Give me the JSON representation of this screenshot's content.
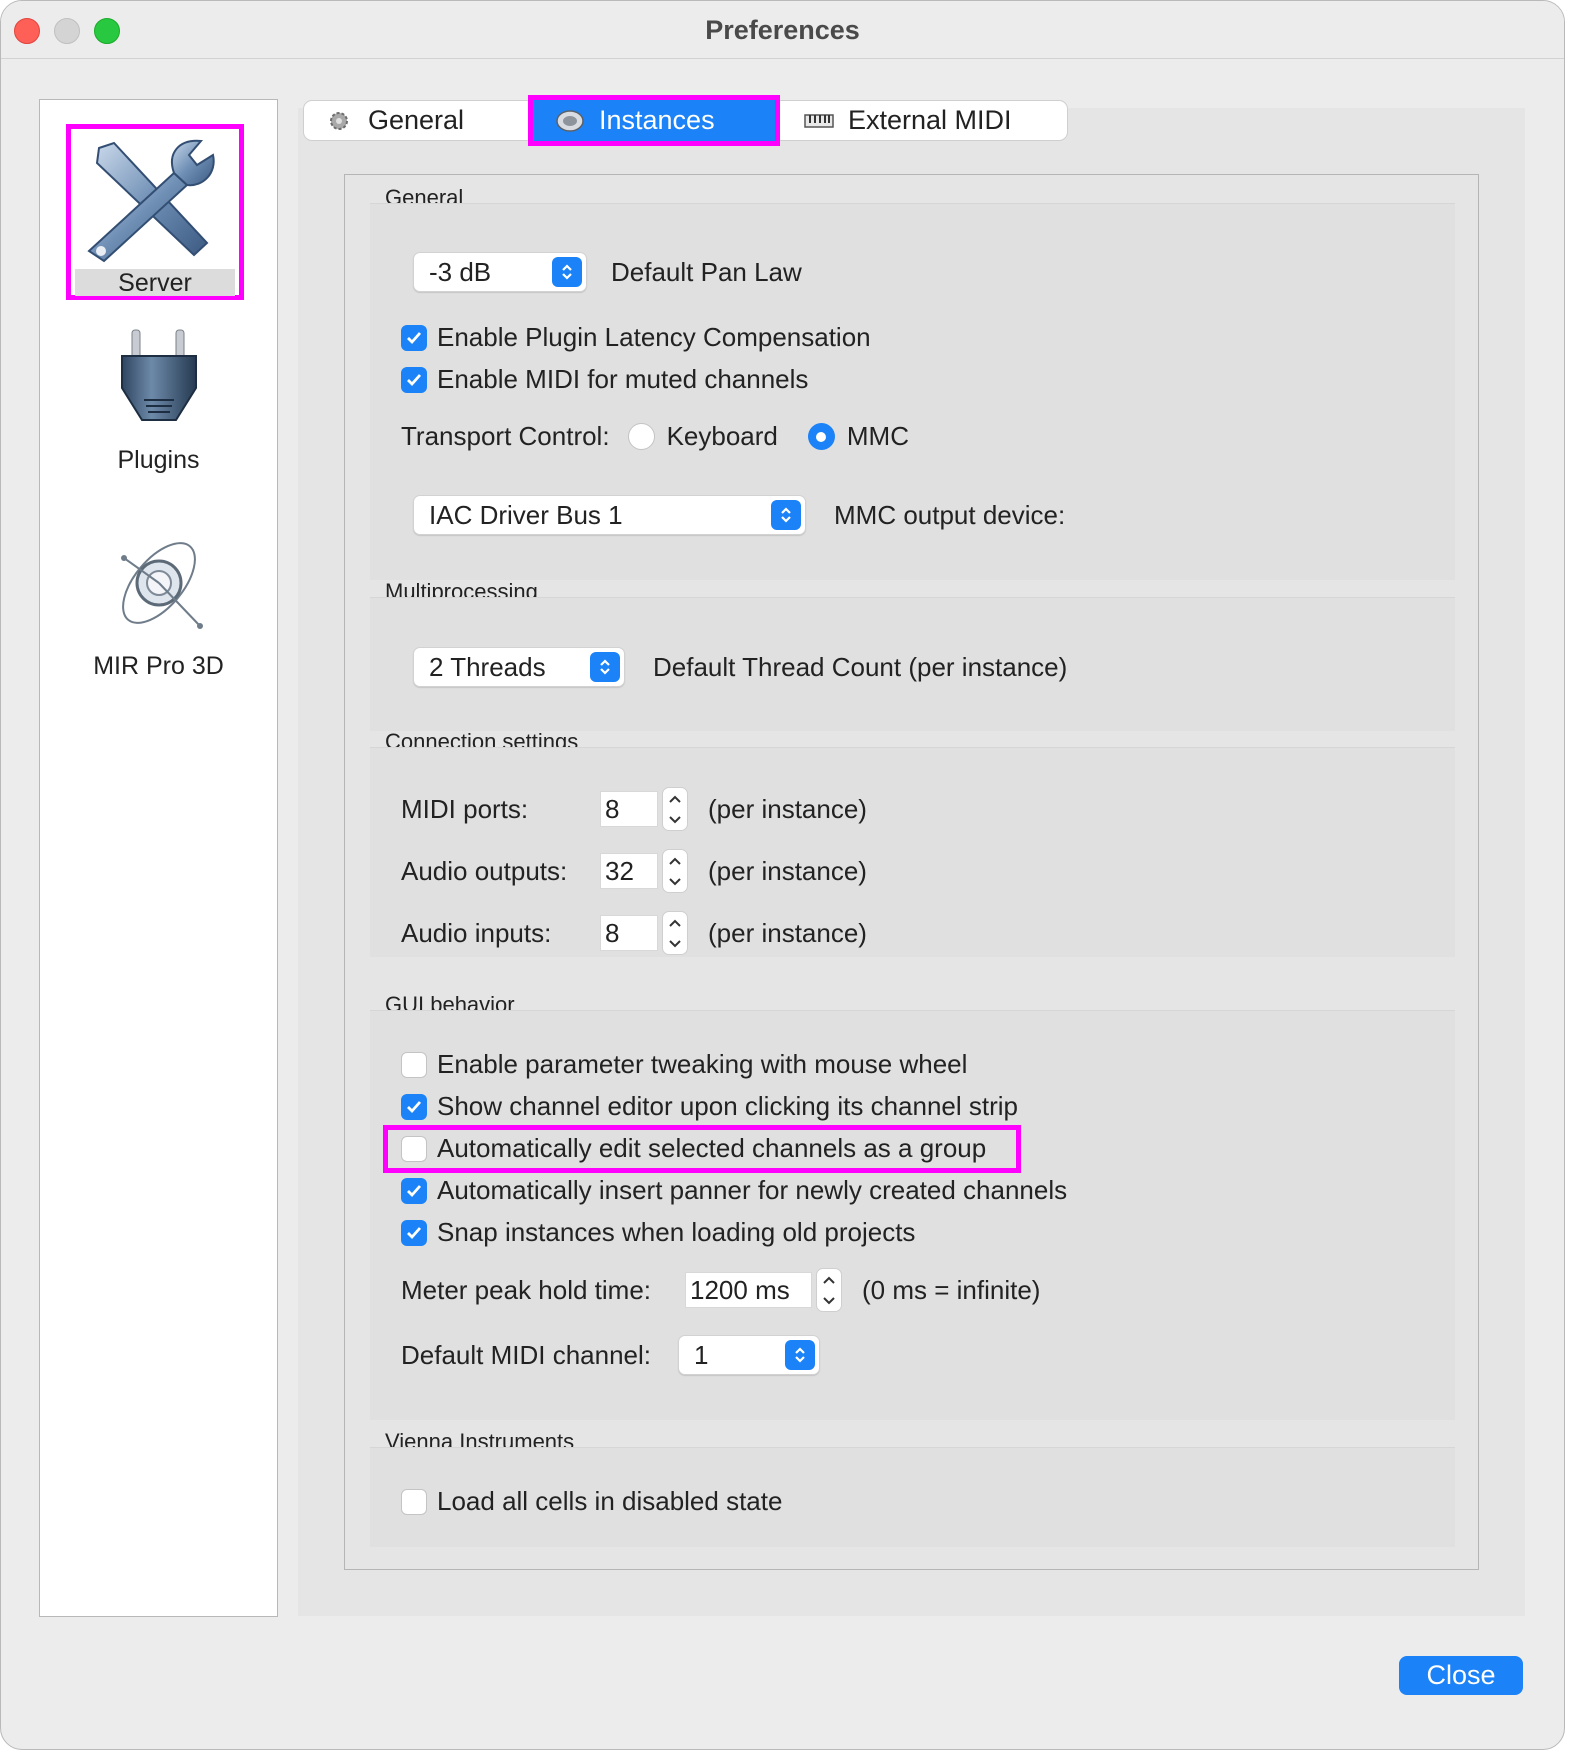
{
  "window": {
    "title": "Preferences"
  },
  "sidebar": {
    "items": [
      {
        "label": "Server",
        "icon": "tools-icon",
        "selected": true
      },
      {
        "label": "Plugins",
        "icon": "plug-icon"
      },
      {
        "label": "MIR Pro 3D",
        "icon": "mir-icon"
      }
    ]
  },
  "tabs": [
    {
      "label": "General",
      "icon": "gear-icon"
    },
    {
      "label": "Instances",
      "icon": "speaker-icon",
      "selected": true
    },
    {
      "label": "External MIDI",
      "icon": "midi-keyboard-icon"
    }
  ],
  "general": {
    "title": "General",
    "pan_law_value": "-3 dB",
    "pan_law_label": "Default Pan Law",
    "latency_comp": {
      "label": "Enable Plugin Latency Compensation",
      "checked": true
    },
    "midi_muted": {
      "label": "Enable MIDI for muted channels",
      "checked": true
    },
    "transport_label": "Transport Control:",
    "transport_keyboard": "Keyboard",
    "transport_mmc": "MMC",
    "transport_selected": "MMC",
    "mmc_device_value": "IAC Driver Bus 1",
    "mmc_device_label": "MMC output device:"
  },
  "multiprocessing": {
    "title": "Multiprocessing",
    "threads_value": "2 Threads",
    "threads_label": "Default Thread Count (per instance)"
  },
  "connection": {
    "title": "Connection settings",
    "midi_ports_label": "MIDI ports:",
    "midi_ports_value": "8",
    "audio_outputs_label": "Audio outputs:",
    "audio_outputs_value": "32",
    "audio_inputs_label": "Audio inputs:",
    "audio_inputs_value": "8",
    "per_instance": "(per instance)"
  },
  "gui": {
    "title": "GUI behavior",
    "mouse_wheel": {
      "label": "Enable parameter tweaking with mouse wheel",
      "checked": false
    },
    "show_editor": {
      "label": "Show channel editor upon clicking its channel strip",
      "checked": true
    },
    "edit_group": {
      "label": "Automatically edit selected channels as a group",
      "checked": false
    },
    "insert_panner": {
      "label": "Automatically insert panner for newly created channels",
      "checked": true
    },
    "snap_instances": {
      "label": "Snap instances when loading old projects",
      "checked": true
    },
    "peak_hold_label": "Meter peak hold time:",
    "peak_hold_value": "1200 ms",
    "peak_hold_note": "(0 ms = infinite)",
    "midi_channel_label": "Default MIDI channel:",
    "midi_channel_value": "1"
  },
  "vienna": {
    "title": "Vienna Instruments",
    "disabled_state": {
      "label": "Load all cells in disabled state",
      "checked": false
    }
  },
  "footer": {
    "close_label": "Close"
  },
  "colors": {
    "accent": "#1b82f7",
    "highlight": "#ff00ff",
    "window_bg": "#ececec"
  }
}
